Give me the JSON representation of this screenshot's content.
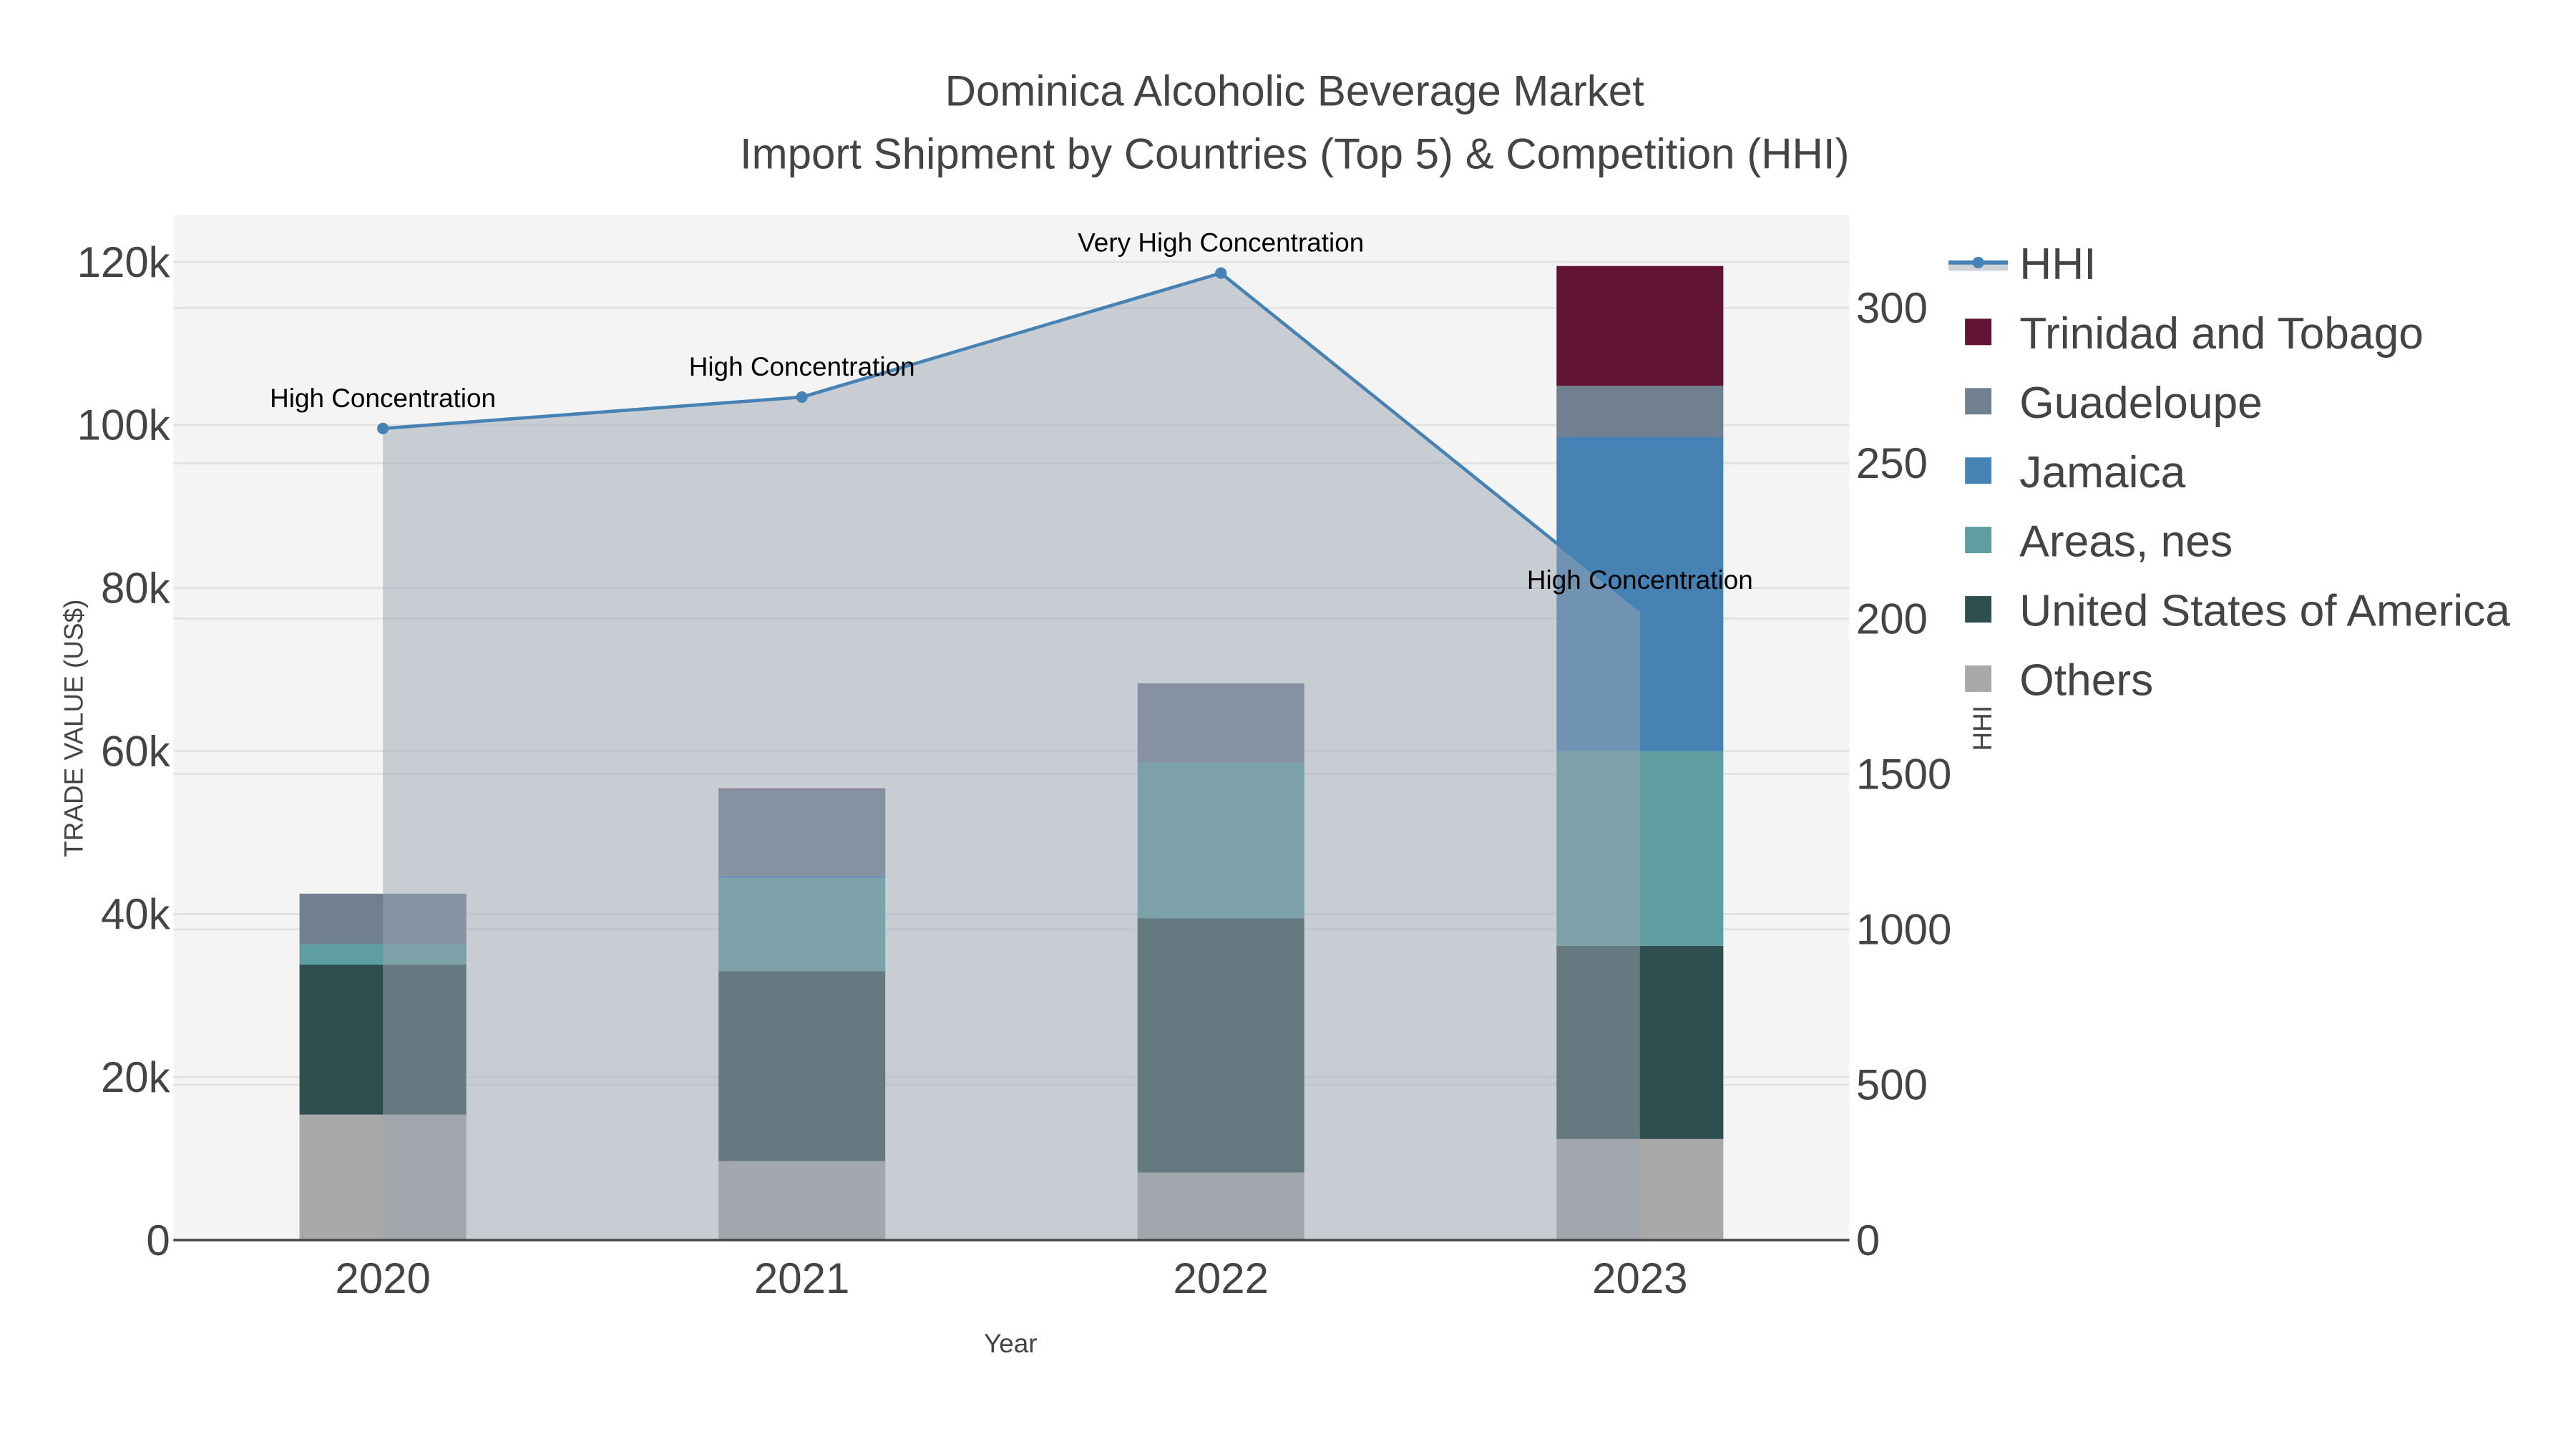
{
  "chart_data": {
    "type": "bar",
    "title": "Dominica Alcoholic Beverage Market",
    "subtitle": "Import Shipment by Countries (Top 5) & Competition (HHI)",
    "xlabel": "Year",
    "ylabel": "TRADE VALUE (US$)",
    "y2label": "HHI",
    "categories": [
      "2020",
      "2021",
      "2022",
      "2023"
    ],
    "ylim": [
      0,
      125800
    ],
    "y_ticks": [
      0,
      20000,
      40000,
      60000,
      80000,
      100000,
      120000
    ],
    "y_tick_labels": [
      "0",
      "20k",
      "40k",
      "60k",
      "80k",
      "100k",
      "120k"
    ],
    "y2lim": [
      0,
      3300
    ],
    "y2_ticks": [
      0,
      500,
      1000,
      1500,
      2000,
      2500,
      3000
    ],
    "y2_tick_labels": [
      "0",
      "500",
      "1000",
      "1500",
      "200",
      "250",
      "300"
    ],
    "barmode": "stack",
    "series": [
      {
        "name": "Others",
        "color": "#A9A9A9",
        "values": [
          15400,
          9700,
          8300,
          12400
        ]
      },
      {
        "name": "United States of America",
        "color": "#2F4F4F",
        "values": [
          18400,
          23300,
          31200,
          23700
        ]
      },
      {
        "name": "Areas, nes",
        "color": "#5F9EA0",
        "values": [
          2500,
          11400,
          19100,
          23900
        ]
      },
      {
        "name": "Jamaica",
        "color": "#4682B4",
        "values": [
          0,
          300,
          0,
          38500
        ]
      },
      {
        "name": "Guadeloupe",
        "color": "#708090",
        "values": [
          6200,
          10600,
          9700,
          6300
        ]
      },
      {
        "name": "Trinidad and Tobago",
        "color": "#611434",
        "values": [
          0,
          100,
          0,
          14700
        ]
      }
    ],
    "hhi": {
      "name": "HHI",
      "color": "#4682B4",
      "values": [
        2612,
        2713,
        3112,
        2027
      ],
      "annotations": [
        "High Concentration",
        "High Concentration",
        "Very High Concentration",
        "High Concentration"
      ]
    },
    "legend_order": [
      "HHI",
      "Trinidad and Tobago",
      "Guadeloupe",
      "Jamaica",
      "Areas, nes",
      "United States of America",
      "Others"
    ],
    "legend_position": "top-right",
    "grid": true
  }
}
